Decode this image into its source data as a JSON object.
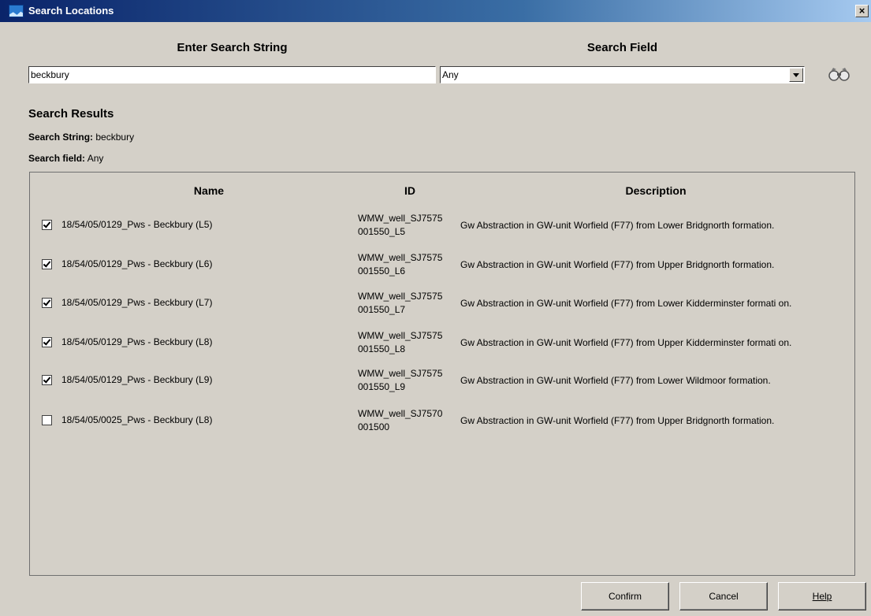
{
  "window": {
    "title": "Search Locations",
    "close_label": "×"
  },
  "search": {
    "string_header": "Enter Search String",
    "field_header": "Search Field",
    "string_value": "beckbury",
    "field_value": "Any"
  },
  "results": {
    "title": "Search Results",
    "search_string_label": "Search String:",
    "search_string_value": "beckbury",
    "search_field_label": "Search field:",
    "search_field_value": "Any",
    "columns": {
      "name": "Name",
      "id": "ID",
      "description": "Description"
    },
    "rows": [
      {
        "checked": true,
        "name": "18/54/05/0129_Pws - Beckbury (L5)",
        "id": "WMW_well_SJ7575 001550_L5",
        "description": "Gw Abstraction in GW-unit Worfield (F77) from Lower Bridgnorth formation."
      },
      {
        "checked": true,
        "name": "18/54/05/0129_Pws - Beckbury (L6)",
        "id": "WMW_well_SJ7575 001550_L6",
        "description": "Gw Abstraction in GW-unit Worfield (F77) from Upper Bridgnorth formation."
      },
      {
        "checked": true,
        "name": "18/54/05/0129_Pws - Beckbury (L7)",
        "id": "WMW_well_SJ7575 001550_L7",
        "description": "Gw Abstraction in GW-unit Worfield (F77) from Lower Kidderminster formati on."
      },
      {
        "checked": true,
        "name": "18/54/05/0129_Pws - Beckbury (L8)",
        "id": "WMW_well_SJ7575 001550_L8",
        "description": "Gw Abstraction in GW-unit Worfield (F77) from Upper Kidderminster formati on."
      },
      {
        "checked": true,
        "name": "18/54/05/0129_Pws - Beckbury (L9)",
        "id": "WMW_well_SJ7575 001550_L9",
        "description": "Gw Abstraction in GW-unit Worfield (F77) from Lower Wildmoor formation."
      },
      {
        "checked": false,
        "name": "18/54/05/0025_Pws - Beckbury (L8)",
        "id": "WMW_well_SJ7570 001500",
        "description": "Gw Abstraction in GW-unit Worfield (F77) from Upper Bridgnorth formation."
      }
    ]
  },
  "buttons": {
    "confirm": "Confirm",
    "cancel": "Cancel",
    "help": "Help"
  },
  "icons": {
    "app": "map-window-icon",
    "search": "binoculars-icon",
    "dropdown": "chevron-down-icon"
  },
  "colors": {
    "dialog_bg": "#d4d0c8",
    "titlebar_start": "#0a246a",
    "titlebar_end": "#a6caf0"
  }
}
